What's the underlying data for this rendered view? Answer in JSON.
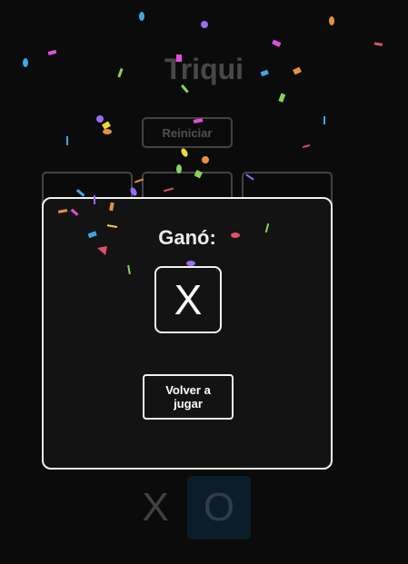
{
  "app": {
    "title": "Triqui"
  },
  "controls": {
    "reset_label": "Reiniciar"
  },
  "board": {
    "cells": [
      "",
      "",
      "",
      "",
      "",
      "",
      "",
      "",
      ""
    ]
  },
  "score": {
    "players": [
      "X",
      "O"
    ],
    "active": "O"
  },
  "modal": {
    "winner_label": "Ganó:",
    "winner": "X",
    "play_again_label": "Volver a jugar"
  },
  "colors": {
    "background": "#0b0b0b",
    "modal_border": "#f2f2f2",
    "active_turn": "#0d4f7a",
    "confetti": [
      "#e04fd8",
      "#3fa7e6",
      "#f0d83a",
      "#e0506a",
      "#9b6cf0",
      "#86d45a",
      "#e8913a"
    ]
  }
}
